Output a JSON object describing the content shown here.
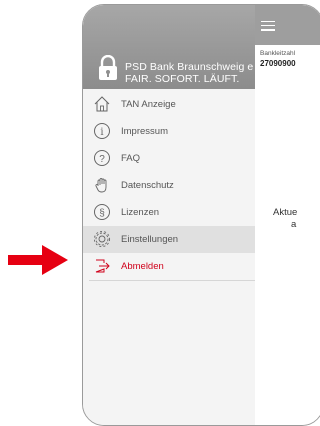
{
  "drawer": {
    "bank_name": "PSD Bank Braunschweig e",
    "slogan": "FAIR. SOFORT. LÄUFT.",
    "items": [
      {
        "label": "TAN Anzeige",
        "icon": "home-icon"
      },
      {
        "label": "Impressum",
        "icon": "info-icon"
      },
      {
        "label": "FAQ",
        "icon": "question-icon"
      },
      {
        "label": "Datenschutz",
        "icon": "hand-icon"
      },
      {
        "label": "Lizenzen",
        "icon": "license-icon"
      },
      {
        "label": "Einstellungen",
        "icon": "gear-icon"
      },
      {
        "label": "Abmelden",
        "icon": "logout-icon"
      }
    ]
  },
  "content": {
    "bank_code_label": "Bankleitzahl",
    "bank_code": "27090900",
    "message_line1": "Aktue",
    "message_line2": "a"
  },
  "colors": {
    "header_gray": "#9e9e9e",
    "selected_bg": "#e0e0e0",
    "logout_red": "#d0021b",
    "arrow_red": "#e60012"
  }
}
